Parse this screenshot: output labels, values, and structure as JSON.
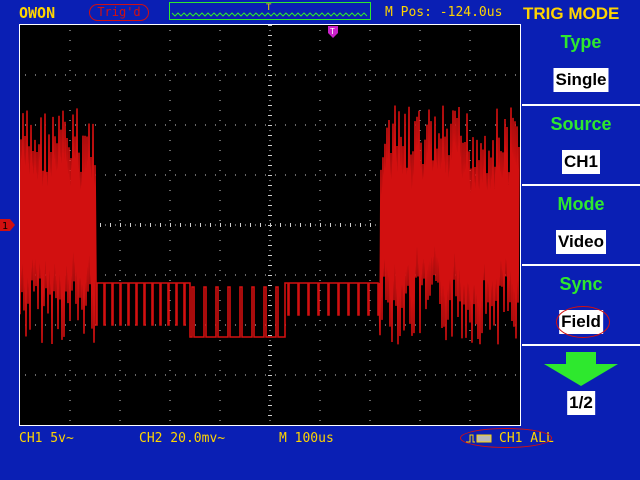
{
  "header": {
    "brand": "OWON",
    "trigger_status": "Trig'd",
    "m_pos": "M Pos: -124.0us",
    "menu_title": "TRIG MODE"
  },
  "menu": {
    "items": [
      {
        "label": "Type",
        "value": "Single"
      },
      {
        "label": "Source",
        "value": "CH1"
      },
      {
        "label": "Mode",
        "value": "Video"
      },
      {
        "label": "Sync",
        "value": "Field"
      }
    ],
    "page": "1/2",
    "page_icon": "down-arrow-icon"
  },
  "status": {
    "ch1": "CH1 5v~",
    "ch2": "CH2 20.0mv~",
    "timebase": "M 100us",
    "trigger_source": "CH1 ALL"
  },
  "markers": {
    "ch1_marker": "1",
    "trigger_marker": "T"
  },
  "colors": {
    "background": "#0a1fb4",
    "screen": "#000000",
    "waveform": "#d21010",
    "accent_yellow": "#ffd400",
    "accent_green": "#2ee82e",
    "grid": "#ffffff"
  }
}
